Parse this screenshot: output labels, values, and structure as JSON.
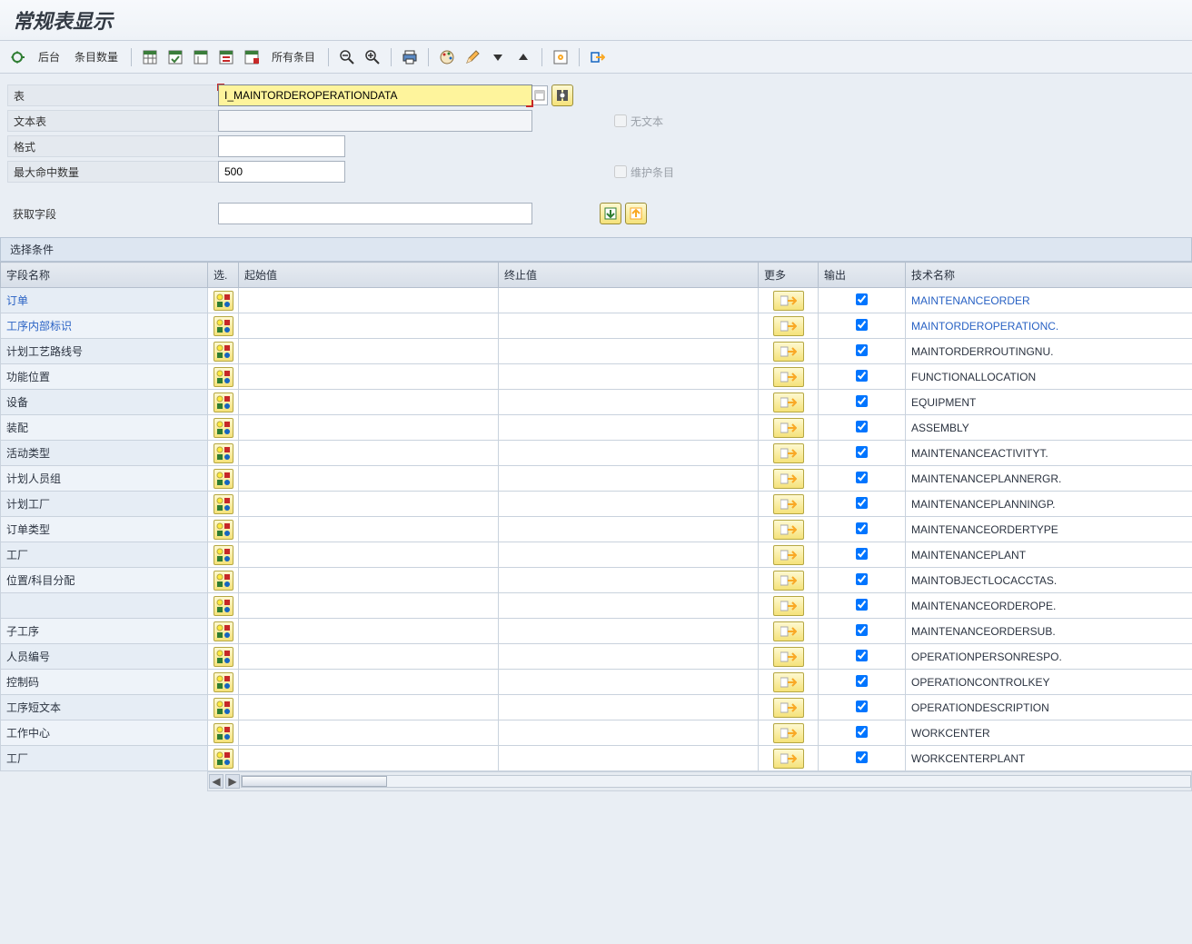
{
  "title": "常规表显示",
  "toolbar": {
    "background": "后台",
    "entries": "条目数量",
    "all_entries": "所有条目"
  },
  "form": {
    "table_label": "表",
    "table_value": "I_MAINTORDEROPERATIONDATA",
    "text_table_label": "文本表",
    "text_table_value": "",
    "format_label": "格式",
    "format_value": "",
    "maxhits_label": "最大命中数量",
    "maxhits_value": "500",
    "no_text_label": "无文本",
    "maintain_entries_label": "维护条目",
    "get_fields_label": "获取字段",
    "get_fields_value": ""
  },
  "section": {
    "selection_title": "选择条件"
  },
  "columns": {
    "field_name": "字段名称",
    "select": "选.",
    "from": "起始值",
    "to": "终止值",
    "more": "更多",
    "output": "输出",
    "tech": "技术名称"
  },
  "rows": [
    {
      "label": "订单",
      "tech": "MAINTENANCEORDER",
      "link": true
    },
    {
      "label": "工序内部标识",
      "tech": "MAINTORDEROPERATIONC.",
      "link": true
    },
    {
      "label": "计划工艺路线号",
      "tech": "MAINTORDERROUTINGNU.",
      "link": false
    },
    {
      "label": "功能位置",
      "tech": "FUNCTIONALLOCATION",
      "link": false
    },
    {
      "label": "设备",
      "tech": "EQUIPMENT",
      "link": false
    },
    {
      "label": "装配",
      "tech": "ASSEMBLY",
      "link": false
    },
    {
      "label": "活动类型",
      "tech": "MAINTENANCEACTIVITYT.",
      "link": false
    },
    {
      "label": "计划人员组",
      "tech": "MAINTENANCEPLANNERGR.",
      "link": false
    },
    {
      "label": "计划工厂",
      "tech": "MAINTENANCEPLANNINGP.",
      "link": false
    },
    {
      "label": "订单类型",
      "tech": "MAINTENANCEORDERTYPE",
      "link": false
    },
    {
      "label": "工厂",
      "tech": "MAINTENANCEPLANT",
      "link": false
    },
    {
      "label": "位置/科目分配",
      "tech": "MAINTOBJECTLOCACCTAS.",
      "link": false
    },
    {
      "label": "",
      "tech": "MAINTENANCEORDEROPE.",
      "link": false
    },
    {
      "label": "子工序",
      "tech": "MAINTENANCEORDERSUB.",
      "link": false
    },
    {
      "label": "人员编号",
      "tech": "OPERATIONPERSONRESPO.",
      "link": false
    },
    {
      "label": "控制码",
      "tech": "OPERATIONCONTROLKEY",
      "link": false
    },
    {
      "label": "工序短文本",
      "tech": "OPERATIONDESCRIPTION",
      "link": false
    },
    {
      "label": "工作中心",
      "tech": "WORKCENTER",
      "link": false
    },
    {
      "label": "工厂",
      "tech": "WORKCENTERPLANT",
      "link": false
    }
  ]
}
